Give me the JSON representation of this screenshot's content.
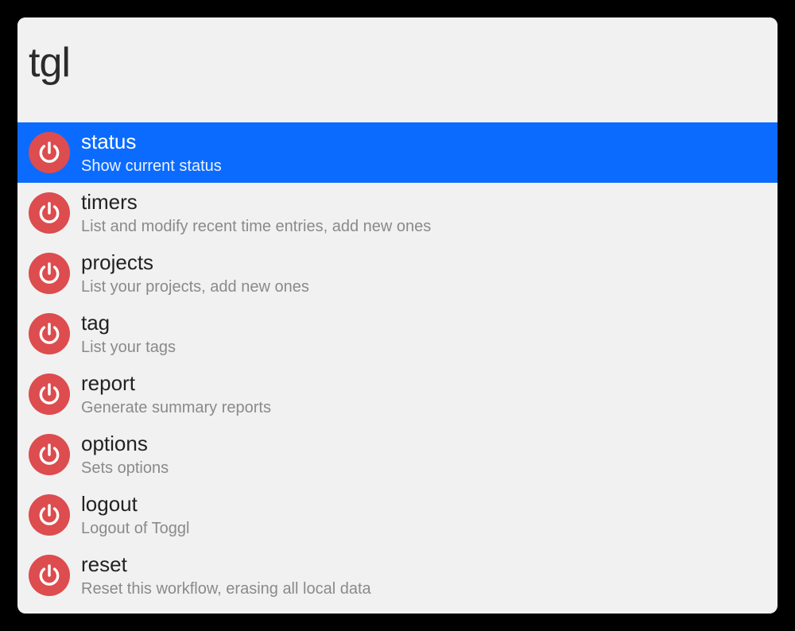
{
  "search": {
    "value": "tgl"
  },
  "colors": {
    "iconBg": "#dd4c4e",
    "iconFg": "#ffffff",
    "selectedBg": "#0b6bff"
  },
  "results": [
    {
      "title": "status",
      "subtitle": "Show current status",
      "selected": true
    },
    {
      "title": "timers",
      "subtitle": "List and modify recent time entries, add new ones",
      "selected": false
    },
    {
      "title": "projects",
      "subtitle": "List your projects, add new ones",
      "selected": false
    },
    {
      "title": "tag",
      "subtitle": "List your tags",
      "selected": false
    },
    {
      "title": "report",
      "subtitle": "Generate summary reports",
      "selected": false
    },
    {
      "title": "options",
      "subtitle": "Sets options",
      "selected": false
    },
    {
      "title": "logout",
      "subtitle": "Logout of Toggl",
      "selected": false
    },
    {
      "title": "reset",
      "subtitle": "Reset this workflow, erasing all local data",
      "selected": false
    }
  ]
}
